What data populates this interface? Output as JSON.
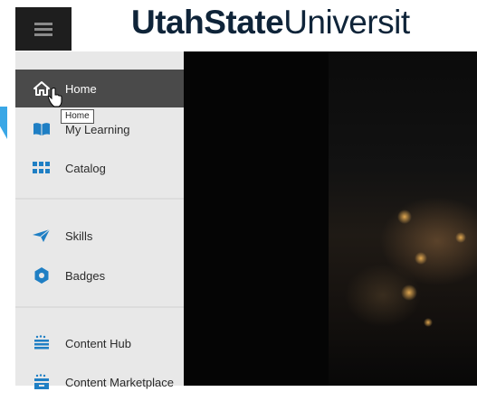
{
  "header": {
    "menu_icon": "hamburger-menu-icon",
    "logo_bold": "UtahState",
    "logo_light": "Universit"
  },
  "sidebar": {
    "items": [
      {
        "label": "Home",
        "icon": "home-icon",
        "active": true
      },
      {
        "label": "My Learning",
        "icon": "book-icon",
        "active": false
      },
      {
        "label": "Catalog",
        "icon": "grid-icon",
        "active": false
      },
      {
        "label": "Skills",
        "icon": "paper-plane-icon",
        "active": false
      },
      {
        "label": "Badges",
        "icon": "badge-icon",
        "active": false
      },
      {
        "label": "Content Hub",
        "icon": "content-hub-icon",
        "active": false
      },
      {
        "label": "Content Marketplace",
        "icon": "marketplace-icon",
        "active": false
      }
    ]
  },
  "tooltip": {
    "text": "Home"
  },
  "colors": {
    "sidebar_bg": "#e8e8e8",
    "active_bg": "#4a4a4a",
    "icon_blue": "#1f7fc4",
    "logo_navy": "#0f2439",
    "accent_blue": "#3aa7e6"
  }
}
